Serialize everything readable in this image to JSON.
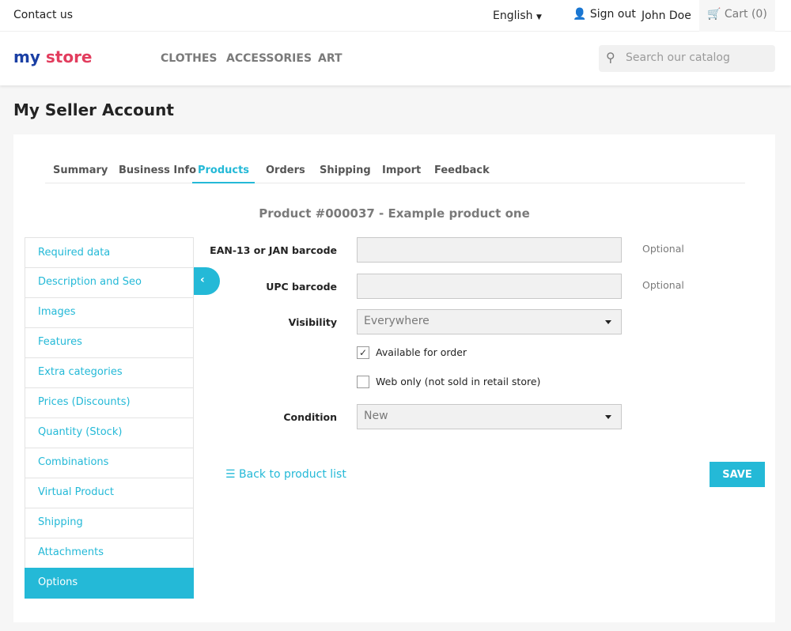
{
  "topbar": {
    "contact": "Contact us",
    "language": "English",
    "sign_out": "Sign out",
    "user": "John Doe",
    "cart": "Cart",
    "cart_count": "(0)"
  },
  "header": {
    "logo": "my store",
    "nav": [
      "CLOTHES",
      "ACCESSORIES",
      "ART"
    ],
    "search_placeholder": "Search our catalog"
  },
  "page": {
    "title": "My Seller Account"
  },
  "tabs": [
    {
      "label": "Summary"
    },
    {
      "label": "Business Info"
    },
    {
      "label": "Products",
      "active": true
    },
    {
      "label": "Orders"
    },
    {
      "label": "Shipping"
    },
    {
      "label": "Import"
    },
    {
      "label": "Feedback"
    }
  ],
  "product_heading": "Product #000037 - Example product one",
  "sidebar": [
    "Required data",
    "Description and Seo",
    "Images",
    "Features",
    "Extra categories",
    "Prices (Discounts)",
    "Quantity (Stock)",
    "Combinations",
    "Virtual Product",
    "Shipping",
    "Attachments",
    "Options"
  ],
  "form": {
    "ean_label": "EAN-13 or JAN barcode",
    "ean_value": "",
    "ean_hint": "Optional",
    "upc_label": "UPC barcode",
    "upc_value": "",
    "upc_hint": "Optional",
    "visibility_label": "Visibility",
    "visibility_value": "Everywhere",
    "available_label": "Available for order",
    "available_checked": true,
    "webonly_label": "Web only (not sold in retail store)",
    "webonly_checked": false,
    "condition_label": "Condition",
    "condition_value": "New"
  },
  "actions": {
    "back": "Back to product list",
    "save": "SAVE"
  },
  "colors": {
    "accent": "#24b9d7"
  }
}
